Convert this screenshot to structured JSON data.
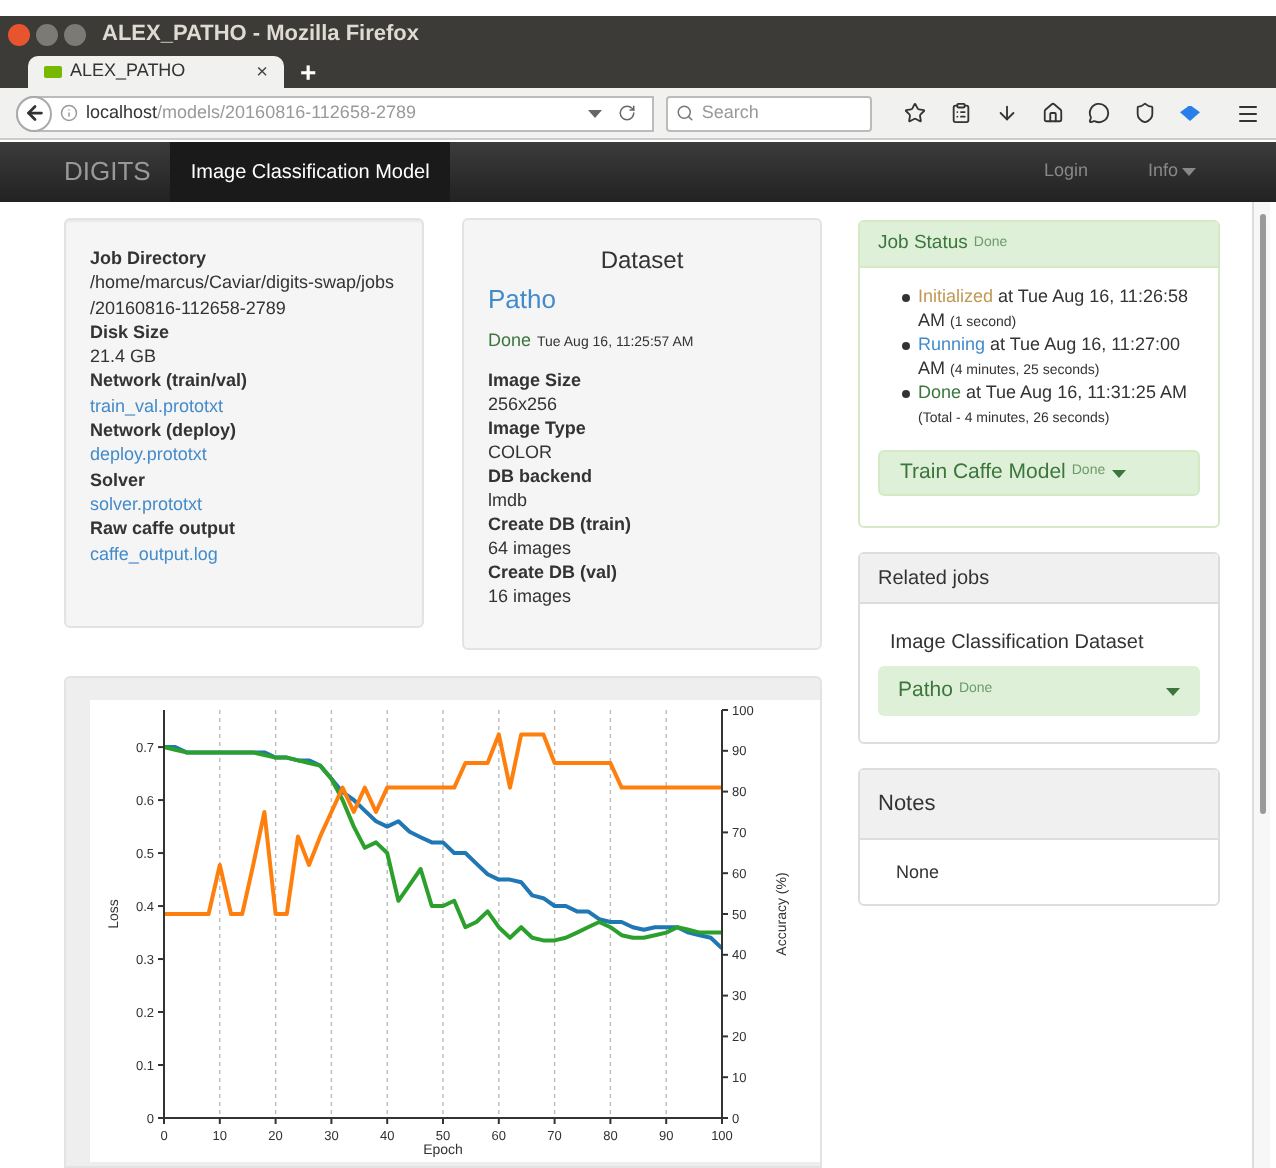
{
  "window": {
    "title": "ALEX_PATHO - Mozilla Firefox"
  },
  "browser": {
    "tab": {
      "title": "ALEX_PATHO",
      "close": "×"
    },
    "new_tab": "+",
    "url": "**localhost**/models/20160816-112658-2789",
    "search": {
      "placeholder": "Search"
    }
  },
  "navbar": {
    "brand": "DIGITS",
    "items": [
      {
        "label": "Image Classification Model",
        "selected": true
      }
    ],
    "right": [
      {
        "label": "Login",
        "dropdown": false
      },
      {
        "label": "Info",
        "dropdown": true
      }
    ]
  },
  "job_info": [
    {
      "label": "Job Directory",
      "value": "/home/marcus/Caviar/digits-swap/jobs /20160816-112658-2789",
      "link": false
    },
    {
      "label": "Disk Size",
      "value": "21.4 GB",
      "link": false
    },
    {
      "label": "Network (train/val)",
      "value": "train_val.prototxt",
      "link": true
    },
    {
      "label": "Network (deploy)",
      "value": "deploy.prototxt",
      "link": true
    },
    {
      "label": "Solver",
      "value": "solver.prototxt",
      "link": true
    },
    {
      "label": "Raw caffe output",
      "value": "caffe_output.log",
      "link": true
    }
  ],
  "dataset": {
    "heading": "Dataset",
    "name": "Patho",
    "status": "Done",
    "time": "Tue Aug 16, 11:25:57 AM",
    "fields": [
      {
        "label": "Image Size",
        "value": "256x256"
      },
      {
        "label": "Image Type",
        "value": "COLOR"
      },
      {
        "label": "DB backend",
        "value": "lmdb"
      },
      {
        "label": "Create DB (train)",
        "value": "64 images"
      },
      {
        "label": "Create DB (val)",
        "value": "16 images"
      }
    ]
  },
  "job_status": {
    "title": "Job Status",
    "status": "Done",
    "events": [
      {
        "kind": "initialized",
        "state": "Initialized",
        "text": "at Tue Aug 16, 11:26:58 AM",
        "duration": "(1 second)"
      },
      {
        "kind": "running",
        "state": "Running",
        "text": "at Tue Aug 16, 11:27:00 AM",
        "duration": "(4 minutes, 25 seconds)"
      },
      {
        "kind": "done",
        "state": "Done",
        "text": "at Tue Aug 16, 11:31:25 AM",
        "duration": "(Total - 4 minutes, 26 seconds)"
      }
    ],
    "task": {
      "label": "Train Caffe Model",
      "status": "Done"
    }
  },
  "related_jobs": {
    "title": "Related jobs",
    "label": "Image Classification Dataset",
    "job": {
      "name": "Patho",
      "status": "Done"
    }
  },
  "notes": {
    "title": "Notes",
    "text": "None"
  },
  "chart": {
    "chart_data": {
      "type": "line",
      "grid": "x",
      "xlabel": "Epoch",
      "ylabel": "Loss",
      "y2label": "Accuracy (%)",
      "xlim": [
        0,
        100
      ],
      "ylim": [
        0,
        0.77
      ],
      "y2lim": [
        0,
        100
      ],
      "xticks": [
        0,
        10,
        20,
        30,
        40,
        50,
        60,
        70,
        80,
        90,
        100
      ],
      "yticks": [
        0,
        0.1,
        0.2,
        0.3,
        0.4,
        0.5,
        0.6,
        0.7
      ],
      "y2ticks": [
        0,
        10,
        20,
        30,
        40,
        50,
        60,
        70,
        80,
        90,
        100
      ],
      "x": [
        0,
        2,
        4,
        6,
        8,
        10,
        12,
        14,
        16,
        18,
        20,
        22,
        24,
        26,
        28,
        30,
        32,
        34,
        36,
        38,
        40,
        42,
        44,
        46,
        48,
        50,
        52,
        54,
        56,
        58,
        60,
        62,
        64,
        66,
        68,
        70,
        72,
        74,
        76,
        78,
        80,
        82,
        84,
        86,
        88,
        90,
        92,
        94,
        96,
        98,
        100
      ],
      "series": [
        {
          "color": "#1f77b4",
          "axis": "y",
          "values": [
            0.7,
            0.7,
            0.69,
            0.69,
            0.69,
            0.69,
            0.69,
            0.69,
            0.69,
            0.69,
            0.68,
            0.68,
            0.675,
            0.675,
            0.665,
            0.64,
            0.615,
            0.6,
            0.58,
            0.56,
            0.55,
            0.56,
            0.54,
            0.53,
            0.52,
            0.52,
            0.5,
            0.5,
            0.48,
            0.46,
            0.45,
            0.45,
            0.445,
            0.42,
            0.415,
            0.4,
            0.4,
            0.39,
            0.39,
            0.375,
            0.37,
            0.37,
            0.36,
            0.355,
            0.36,
            0.36,
            0.36,
            0.35,
            0.345,
            0.34,
            0.32
          ]
        },
        {
          "color": "#2ca02c",
          "axis": "y",
          "values": [
            0.7,
            0.695,
            0.69,
            0.69,
            0.69,
            0.69,
            0.69,
            0.69,
            0.69,
            0.685,
            0.68,
            0.68,
            0.675,
            0.67,
            0.665,
            0.64,
            0.6,
            0.55,
            0.51,
            0.52,
            0.5,
            0.41,
            0.44,
            0.47,
            0.4,
            0.4,
            0.41,
            0.36,
            0.37,
            0.39,
            0.36,
            0.34,
            0.36,
            0.34,
            0.335,
            0.335,
            0.34,
            0.35,
            0.36,
            0.37,
            0.36,
            0.345,
            0.34,
            0.34,
            0.345,
            0.35,
            0.36,
            0.355,
            0.35,
            0.35,
            0.35
          ]
        },
        {
          "color": "#ff7f0e",
          "axis": "y2",
          "values": [
            50,
            50,
            50,
            50,
            50,
            62,
            50,
            50,
            62,
            75,
            50,
            50,
            69,
            62,
            69,
            75,
            81,
            75,
            81,
            75,
            81,
            81,
            81,
            81,
            81,
            81,
            81,
            87,
            87,
            87,
            94,
            81,
            94,
            94,
            94,
            87,
            87,
            87,
            87,
            87,
            87,
            81,
            81,
            81,
            81,
            81,
            81,
            81,
            81,
            81,
            81
          ]
        }
      ]
    }
  }
}
